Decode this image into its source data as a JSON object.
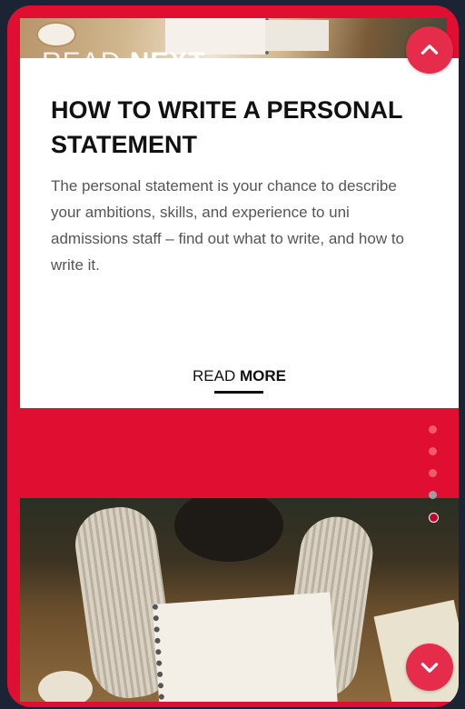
{
  "read_next": {
    "prefix": "READ",
    "highlight": "NEXT"
  },
  "article": {
    "title": "HOW TO WRITE A PERSONAL STATEMENT",
    "body": "The personal statement is your chance to describe your ambitions, skills, and experience to uni admissions staff – find out what to write, and how to write it.",
    "read_more_prefix": "READ",
    "read_more_bold": "MORE"
  },
  "pagination": {
    "total": 5,
    "active_index": 4
  },
  "icons": {
    "up": "chevron-up-icon",
    "down": "chevron-down-icon"
  },
  "colors": {
    "accent": "#e00f31",
    "button": "#e52c4b",
    "background": "#1b2434"
  }
}
